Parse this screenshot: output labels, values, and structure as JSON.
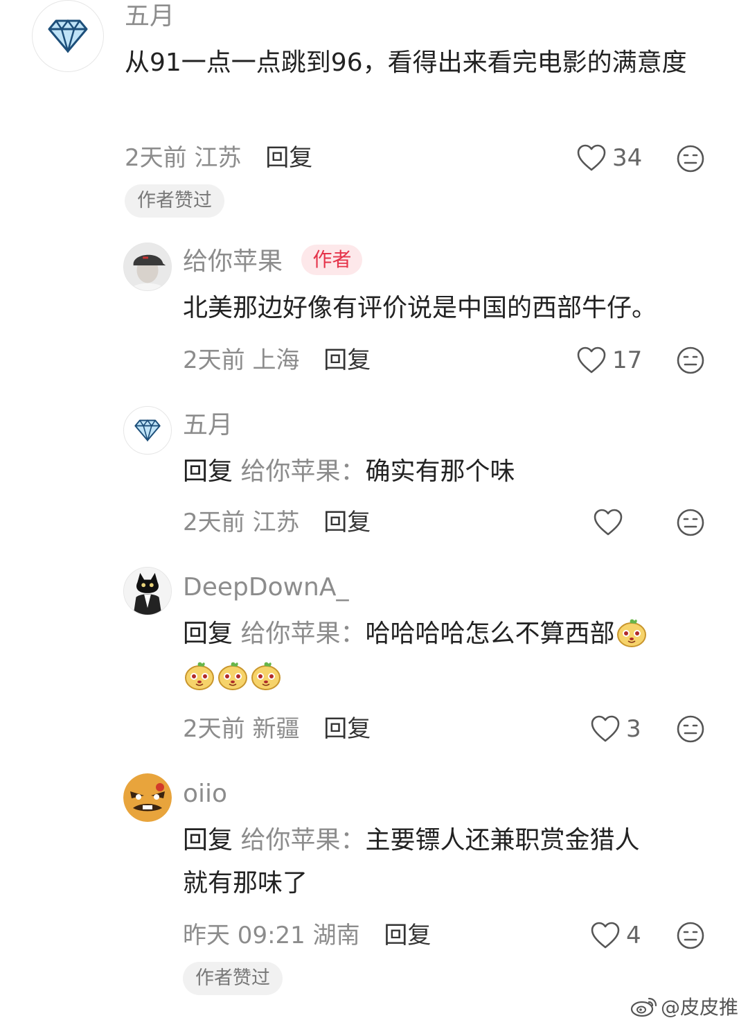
{
  "comments": {
    "c1": {
      "name": "五月",
      "text": "从91一点一点跳到96，看得出来看完电影的满意度",
      "time": "2天前",
      "location": "江苏",
      "reply_label": "回复",
      "likes": "34",
      "chip": "作者赞过"
    },
    "c2": {
      "name": "给你苹果",
      "badge": "作者",
      "text": "北美那边好像有评价说是中国的西部牛仔。",
      "time": "2天前",
      "location": "上海",
      "reply_label": "回复",
      "likes": "17"
    },
    "c3": {
      "name": "五月",
      "reply_prefix": "回复",
      "reply_target": "给你苹果：",
      "text": "确实有那个味",
      "time": "2天前",
      "location": "江苏",
      "reply_label": "回复",
      "likes": ""
    },
    "c4": {
      "name": "DeepDownA_",
      "reply_prefix": "回复",
      "reply_target": "给你苹果：",
      "text": "哈哈哈哈怎么不算西部",
      "time": "2天前",
      "location": "新疆",
      "reply_label": "回复",
      "likes": "3"
    },
    "c5": {
      "name": "oiio",
      "reply_prefix": "回复",
      "reply_target": "给你苹果：",
      "text_line1": "主要镖人还兼职赏金猎人",
      "text_line2": "就有那味了",
      "time": "昨天 09:21",
      "location": "湖南",
      "reply_label": "回复",
      "likes": "4",
      "chip": "作者赞过"
    }
  },
  "icons": {
    "like": "heart-outline-icon",
    "dislike": "neutral-face-icon",
    "emoji": "potato-emoji-icon"
  },
  "colors": {
    "muted": "#8c8c8c",
    "author_badge_bg": "#fde8ea",
    "author_badge_fg": "#e5334a",
    "chip_bg": "#f1f1f1"
  },
  "watermark": "@皮皮推"
}
